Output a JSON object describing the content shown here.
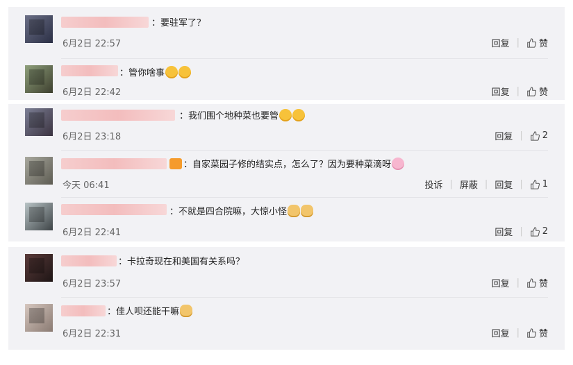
{
  "blocks": [
    {
      "comments": [
        {
          "text": "：要驻军了？",
          "time": "6月2日 22:57",
          "reply": "回复",
          "like": "赞",
          "emojis": []
        },
        {
          "text": "：管你啥事",
          "time": "6月2日 22:42",
          "reply": "回复",
          "like": "赞",
          "emojis": [
            "emoji",
            "emoji"
          ]
        }
      ]
    },
    {
      "comments": [
        {
          "text": "：我们围个地种菜也要管",
          "time": "6月2日 23:18",
          "reply": "回复",
          "like": "2",
          "emojis": [
            "emoji",
            "emoji"
          ]
        },
        {
          "text": "：自家菜园子修的结实点，怎么了？因为要种菜滴呀",
          "time": "今天 06:41",
          "report": "投诉",
          "block": "屏蔽",
          "reply": "回复",
          "like": "1",
          "emojis": [
            "pink"
          ]
        },
        {
          "text": "：不就是四合院嘛，大惊小怪",
          "time": "6月2日 22:41",
          "reply": "回复",
          "like": "2",
          "emojis": [
            "cat",
            "cat"
          ]
        }
      ]
    },
    {
      "comments": [
        {
          "text": "：卡拉奇现在和美国有关系吗？",
          "time": "6月2日 23:57",
          "reply": "回复",
          "like": "赞",
          "emojis": []
        },
        {
          "text": "：佳人呗还能干嘛",
          "time": "6月2日 22:31",
          "reply": "回复",
          "like": "赞",
          "emojis": [
            "cat"
          ]
        }
      ]
    }
  ]
}
